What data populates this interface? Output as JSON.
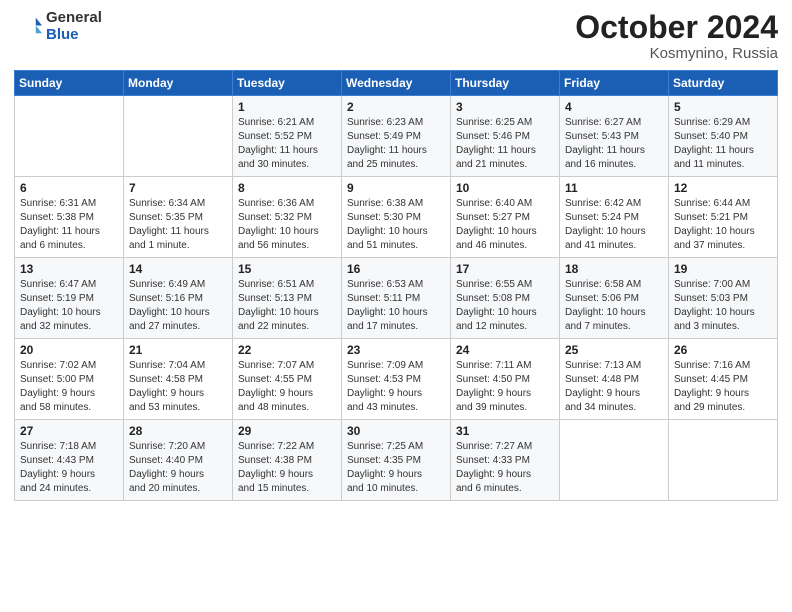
{
  "header": {
    "logo_general": "General",
    "logo_blue": "Blue",
    "month": "October 2024",
    "location": "Kosmynino, Russia"
  },
  "days_of_week": [
    "Sunday",
    "Monday",
    "Tuesday",
    "Wednesday",
    "Thursday",
    "Friday",
    "Saturday"
  ],
  "weeks": [
    [
      {
        "day": "",
        "info": ""
      },
      {
        "day": "",
        "info": ""
      },
      {
        "day": "1",
        "info": "Sunrise: 6:21 AM\nSunset: 5:52 PM\nDaylight: 11 hours\nand 30 minutes."
      },
      {
        "day": "2",
        "info": "Sunrise: 6:23 AM\nSunset: 5:49 PM\nDaylight: 11 hours\nand 25 minutes."
      },
      {
        "day": "3",
        "info": "Sunrise: 6:25 AM\nSunset: 5:46 PM\nDaylight: 11 hours\nand 21 minutes."
      },
      {
        "day": "4",
        "info": "Sunrise: 6:27 AM\nSunset: 5:43 PM\nDaylight: 11 hours\nand 16 minutes."
      },
      {
        "day": "5",
        "info": "Sunrise: 6:29 AM\nSunset: 5:40 PM\nDaylight: 11 hours\nand 11 minutes."
      }
    ],
    [
      {
        "day": "6",
        "info": "Sunrise: 6:31 AM\nSunset: 5:38 PM\nDaylight: 11 hours\nand 6 minutes."
      },
      {
        "day": "7",
        "info": "Sunrise: 6:34 AM\nSunset: 5:35 PM\nDaylight: 11 hours\nand 1 minute."
      },
      {
        "day": "8",
        "info": "Sunrise: 6:36 AM\nSunset: 5:32 PM\nDaylight: 10 hours\nand 56 minutes."
      },
      {
        "day": "9",
        "info": "Sunrise: 6:38 AM\nSunset: 5:30 PM\nDaylight: 10 hours\nand 51 minutes."
      },
      {
        "day": "10",
        "info": "Sunrise: 6:40 AM\nSunset: 5:27 PM\nDaylight: 10 hours\nand 46 minutes."
      },
      {
        "day": "11",
        "info": "Sunrise: 6:42 AM\nSunset: 5:24 PM\nDaylight: 10 hours\nand 41 minutes."
      },
      {
        "day": "12",
        "info": "Sunrise: 6:44 AM\nSunset: 5:21 PM\nDaylight: 10 hours\nand 37 minutes."
      }
    ],
    [
      {
        "day": "13",
        "info": "Sunrise: 6:47 AM\nSunset: 5:19 PM\nDaylight: 10 hours\nand 32 minutes."
      },
      {
        "day": "14",
        "info": "Sunrise: 6:49 AM\nSunset: 5:16 PM\nDaylight: 10 hours\nand 27 minutes."
      },
      {
        "day": "15",
        "info": "Sunrise: 6:51 AM\nSunset: 5:13 PM\nDaylight: 10 hours\nand 22 minutes."
      },
      {
        "day": "16",
        "info": "Sunrise: 6:53 AM\nSunset: 5:11 PM\nDaylight: 10 hours\nand 17 minutes."
      },
      {
        "day": "17",
        "info": "Sunrise: 6:55 AM\nSunset: 5:08 PM\nDaylight: 10 hours\nand 12 minutes."
      },
      {
        "day": "18",
        "info": "Sunrise: 6:58 AM\nSunset: 5:06 PM\nDaylight: 10 hours\nand 7 minutes."
      },
      {
        "day": "19",
        "info": "Sunrise: 7:00 AM\nSunset: 5:03 PM\nDaylight: 10 hours\nand 3 minutes."
      }
    ],
    [
      {
        "day": "20",
        "info": "Sunrise: 7:02 AM\nSunset: 5:00 PM\nDaylight: 9 hours\nand 58 minutes."
      },
      {
        "day": "21",
        "info": "Sunrise: 7:04 AM\nSunset: 4:58 PM\nDaylight: 9 hours\nand 53 minutes."
      },
      {
        "day": "22",
        "info": "Sunrise: 7:07 AM\nSunset: 4:55 PM\nDaylight: 9 hours\nand 48 minutes."
      },
      {
        "day": "23",
        "info": "Sunrise: 7:09 AM\nSunset: 4:53 PM\nDaylight: 9 hours\nand 43 minutes."
      },
      {
        "day": "24",
        "info": "Sunrise: 7:11 AM\nSunset: 4:50 PM\nDaylight: 9 hours\nand 39 minutes."
      },
      {
        "day": "25",
        "info": "Sunrise: 7:13 AM\nSunset: 4:48 PM\nDaylight: 9 hours\nand 34 minutes."
      },
      {
        "day": "26",
        "info": "Sunrise: 7:16 AM\nSunset: 4:45 PM\nDaylight: 9 hours\nand 29 minutes."
      }
    ],
    [
      {
        "day": "27",
        "info": "Sunrise: 7:18 AM\nSunset: 4:43 PM\nDaylight: 9 hours\nand 24 minutes."
      },
      {
        "day": "28",
        "info": "Sunrise: 7:20 AM\nSunset: 4:40 PM\nDaylight: 9 hours\nand 20 minutes."
      },
      {
        "day": "29",
        "info": "Sunrise: 7:22 AM\nSunset: 4:38 PM\nDaylight: 9 hours\nand 15 minutes."
      },
      {
        "day": "30",
        "info": "Sunrise: 7:25 AM\nSunset: 4:35 PM\nDaylight: 9 hours\nand 10 minutes."
      },
      {
        "day": "31",
        "info": "Sunrise: 7:27 AM\nSunset: 4:33 PM\nDaylight: 9 hours\nand 6 minutes."
      },
      {
        "day": "",
        "info": ""
      },
      {
        "day": "",
        "info": ""
      }
    ]
  ]
}
